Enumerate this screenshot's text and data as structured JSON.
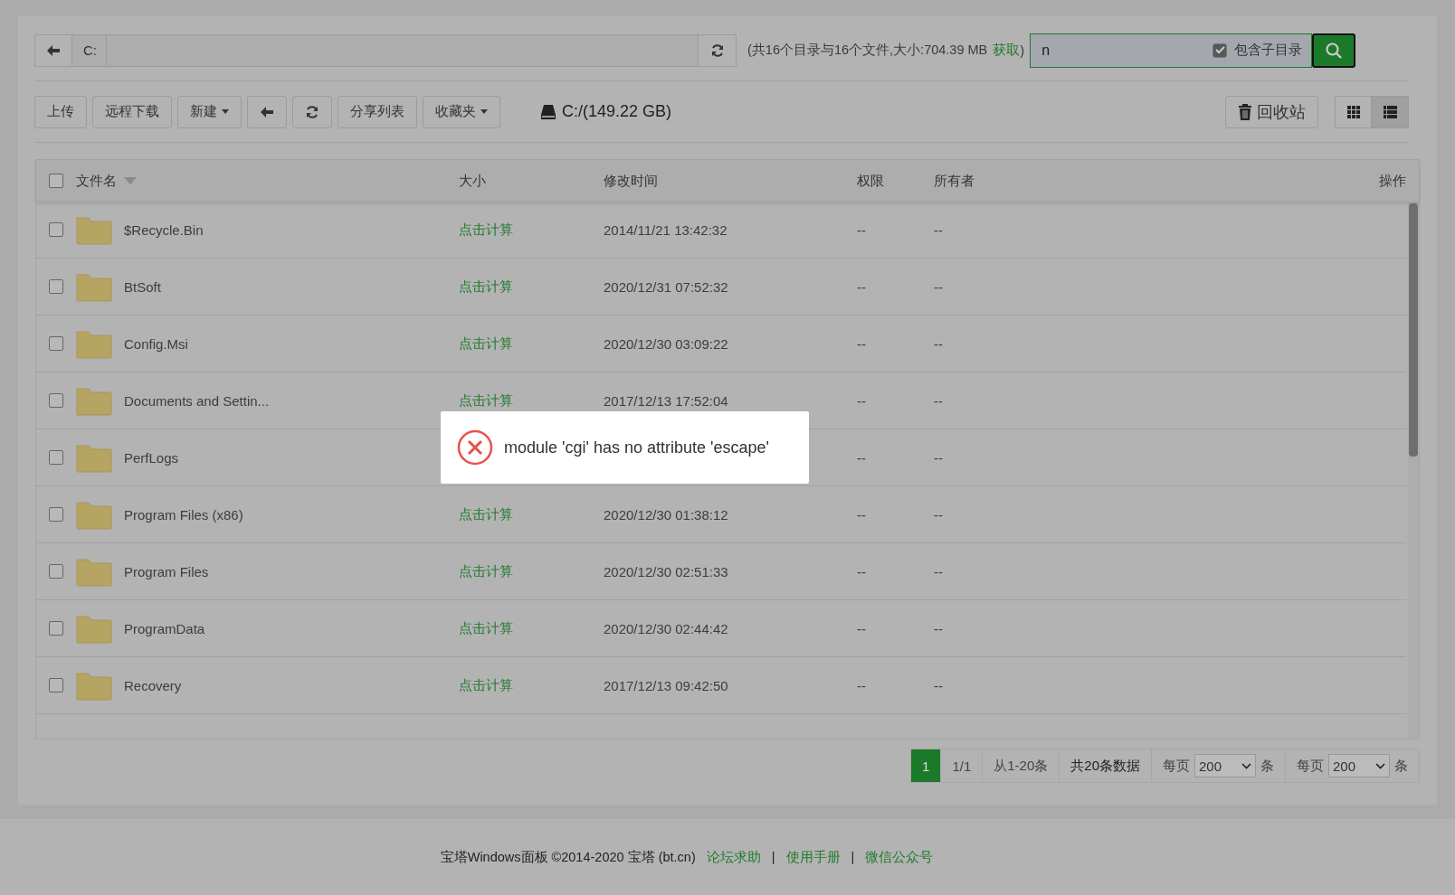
{
  "path_bar": {
    "segments": [
      "C:"
    ]
  },
  "summary": {
    "text": "(共16个目录与16个文件,大小:704.39 MB",
    "link": "获取",
    "close": ")"
  },
  "search": {
    "value": "n",
    "include_subdirs": {
      "label": "包含子目录",
      "checked": true
    }
  },
  "toolbar": {
    "buttons": [
      {
        "kind": "text",
        "label": "上传"
      },
      {
        "kind": "text",
        "label": "远程下载"
      },
      {
        "kind": "dropdown",
        "label": "新建"
      },
      {
        "kind": "back"
      },
      {
        "kind": "refresh"
      },
      {
        "kind": "text",
        "label": "分享列表"
      },
      {
        "kind": "dropdown",
        "label": "收藏夹"
      }
    ],
    "drive": "C:/(149.22 GB)",
    "recycle": "回收站",
    "views": [
      {
        "kind": "grid",
        "selected": false
      },
      {
        "kind": "list",
        "selected": true
      }
    ]
  },
  "table": {
    "select_all": {
      "checked": false
    },
    "columns": [
      "文件名",
      "大小",
      "修改时间",
      "权限",
      "所有者",
      "操作"
    ],
    "rows": [
      {
        "name": "$Recycle.Bin",
        "size": "点击计算",
        "modified": "2014/11/21 13:42:32",
        "permissions": "--",
        "owner": "--",
        "checked": false
      },
      {
        "name": "BtSoft",
        "size": "点击计算",
        "modified": "2020/12/31 07:52:32",
        "permissions": "--",
        "owner": "--",
        "checked": false
      },
      {
        "name": "Config.Msi",
        "size": "点击计算",
        "modified": "2020/12/30 03:09:22",
        "permissions": "--",
        "owner": "--",
        "checked": false
      },
      {
        "name": "Documents and Settin...",
        "size": "点击计算",
        "modified": "2017/12/13 17:52:04",
        "permissions": "--",
        "owner": "--",
        "checked": false
      },
      {
        "name": "PerfLogs",
        "permissions": "--",
        "owner": "--",
        "checked": false
      },
      {
        "name": "Program Files (x86)",
        "size": "点击计算",
        "modified": "2020/12/30 01:38:12",
        "permissions": "--",
        "owner": "--",
        "checked": false
      },
      {
        "name": "Program Files",
        "size": "点击计算",
        "modified": "2020/12/30 02:51:33",
        "permissions": "--",
        "owner": "--",
        "checked": false
      },
      {
        "name": "ProgramData",
        "size": "点击计算",
        "modified": "2020/12/30 02:44:42",
        "permissions": "--",
        "owner": "--",
        "checked": false
      },
      {
        "name": "Recovery",
        "size": "点击计算",
        "modified": "2017/12/13 09:42:50",
        "permissions": "--",
        "owner": "--",
        "checked": false
      }
    ]
  },
  "toast": {
    "message": "module 'cgi' has no attribute 'escape'"
  },
  "pagination": {
    "current": "1",
    "pages": "1/1",
    "range": "从1-20条",
    "total": "共20条数据",
    "per_page": [
      {
        "prefix": "每页",
        "value": "200",
        "suffix": "条"
      },
      {
        "prefix": "每页",
        "value": "200",
        "suffix": "条"
      }
    ]
  },
  "footer": {
    "text": "宝塔Windows面板 ©2014-2020 宝塔 (bt.cn)",
    "links": [
      "论坛求助",
      "使用手册",
      "微信公众号"
    ],
    "separators": [
      "|",
      "|"
    ]
  }
}
